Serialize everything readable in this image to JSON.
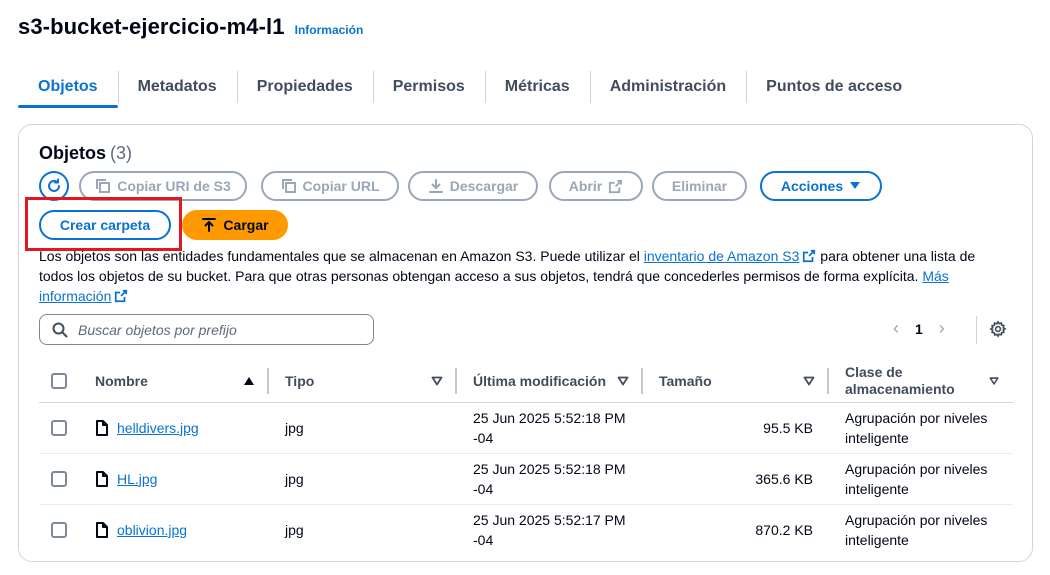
{
  "header": {
    "title": "s3-bucket-ejercicio-m4-l1",
    "info_link": "Información"
  },
  "tabs": [
    {
      "label": "Objetos",
      "active": true
    },
    {
      "label": "Metadatos"
    },
    {
      "label": "Propiedades"
    },
    {
      "label": "Permisos"
    },
    {
      "label": "Métricas"
    },
    {
      "label": "Administración"
    },
    {
      "label": "Puntos de acceso"
    }
  ],
  "panel": {
    "title": "Objetos",
    "count": "(3)",
    "toolbar": {
      "copy_uri": "Copiar URI de S3",
      "copy_url": "Copiar URL",
      "download": "Descargar",
      "open": "Abrir",
      "delete": "Eliminar",
      "actions": "Acciones",
      "create_folder": "Crear carpeta",
      "upload": "Cargar"
    },
    "description": {
      "part1": "Los objetos son las entidades fundamentales que se almacenan en Amazon S3. Puede utilizar el ",
      "link1": "inventario de Amazon S3",
      "part2": " para obtener una lista de todos los objetos de su bucket. Para que otras personas obtengan acceso a sus objetos, tendrá que concederles permisos de forma explícita. ",
      "link2": "Más información"
    },
    "search": {
      "placeholder": "Buscar objetos por prefijo"
    },
    "pagination": {
      "page": "1"
    }
  },
  "table": {
    "columns": [
      "Nombre",
      "Tipo",
      "Última modificación",
      "Tamaño",
      "Clase de almacenamiento"
    ],
    "rows": [
      {
        "name": "helldivers.jpg",
        "type": "jpg",
        "modified": "25 Jun 2025 5:52:18 PM -04",
        "size": "95.5 KB",
        "class": "Agrupación por niveles inteligente"
      },
      {
        "name": "HL.jpg",
        "type": "jpg",
        "modified": "25 Jun 2025 5:52:18 PM -04",
        "size": "365.6 KB",
        "class": "Agrupación por niveles inteligente"
      },
      {
        "name": "oblivion.jpg",
        "type": "jpg",
        "modified": "25 Jun 2025 5:52:17 PM -04",
        "size": "870.2 KB",
        "class": "Agrupación por niveles inteligente"
      }
    ]
  },
  "colors": {
    "accent": "#0972d3",
    "upload": "#ff9900",
    "highlight": "#e0181f"
  }
}
